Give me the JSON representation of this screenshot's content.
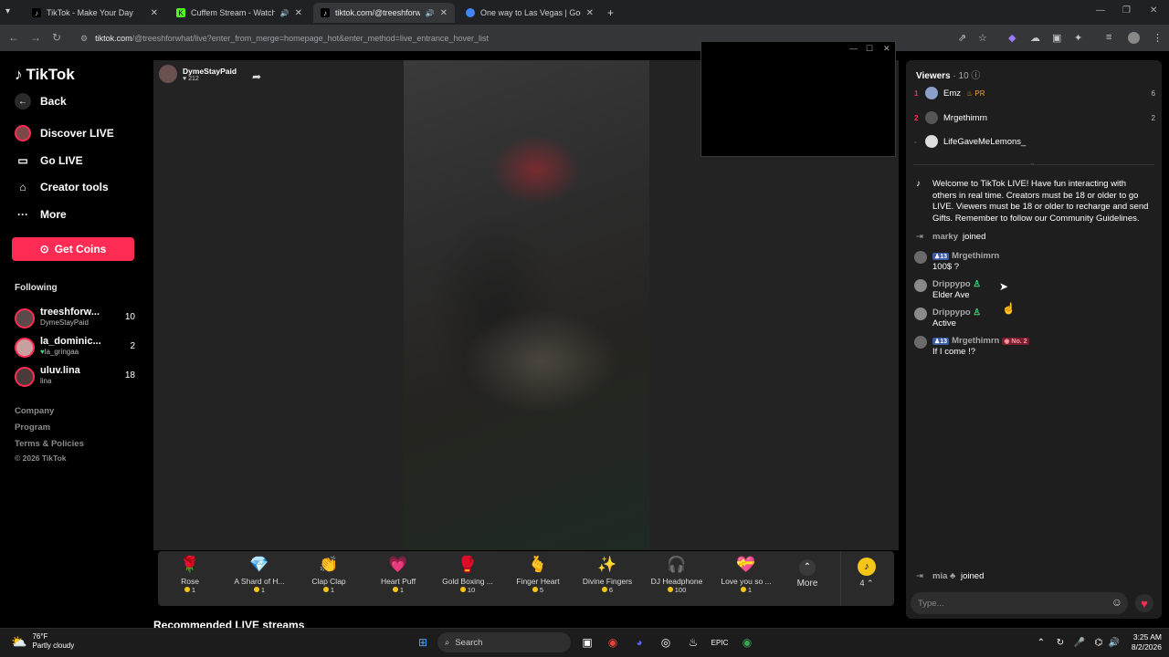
{
  "browser": {
    "tabs": [
      {
        "title": "TikTok - Make Your Day",
        "left": 0
      },
      {
        "title": "Cuffem Stream - Watch Live",
        "left": 0
      },
      {
        "title": "tiktok.com/@treeshforwhat",
        "left": 0
      },
      {
        "title": "One way to Las Vegas | Google",
        "left": 0
      }
    ],
    "url_host": "tiktok.com",
    "url_rest": "/@treeshforwhat/live?enter_from_merge=homepage_hot&enter_method=live_entrance_hover_list"
  },
  "nav": {
    "logo": "TikTok",
    "back": "Back",
    "items": [
      "Discover LIVE",
      "Go LIVE",
      "Creator tools",
      "More"
    ],
    "coins": "Get Coins",
    "following_title": "Following",
    "following": [
      {
        "name": "treeshforw...",
        "sub": "DymeStayPaid",
        "count": "10"
      },
      {
        "name": "la_dominic...",
        "sub": "la_gringaa",
        "count": "2"
      },
      {
        "name": "uluv.lina",
        "sub": "lina",
        "count": "18"
      }
    ],
    "footer": [
      "Company",
      "Program",
      "Terms & Policies",
      "© 2026 TikTok"
    ]
  },
  "stream": {
    "host_name": "DymeStayPaid",
    "host_likes": "212",
    "recommended_title": "Recommended LIVE streams"
  },
  "gifts": [
    {
      "name": "Rose",
      "price": "1",
      "icon": "🌹"
    },
    {
      "name": "A Shard of H...",
      "price": "1",
      "icon": "💎"
    },
    {
      "name": "Clap Clap",
      "price": "1",
      "icon": "👏"
    },
    {
      "name": "Heart Puff",
      "price": "1",
      "icon": "💗"
    },
    {
      "name": "Gold Boxing ...",
      "price": "10",
      "icon": "🥊"
    },
    {
      "name": "Finger Heart",
      "price": "5",
      "icon": "🫰"
    },
    {
      "name": "Divine Fingers",
      "price": "6",
      "icon": "✨"
    },
    {
      "name": "DJ Headphone",
      "price": "100",
      "icon": "🎧"
    },
    {
      "name": "Love you so ...",
      "price": "1",
      "icon": "💝"
    }
  ],
  "gifts_more": "More",
  "coin_balance": "4",
  "viewers": {
    "title": "Viewers",
    "count": "· 10",
    "list": [
      {
        "rank": "1",
        "name": "Emz",
        "score": "6"
      },
      {
        "rank": "2",
        "name": "Mrgethimrn",
        "score": "2"
      },
      {
        "rank": "-",
        "name": "LifeGaveMeLemons_",
        "score": ""
      }
    ]
  },
  "chat": {
    "welcome": "Welcome to TikTok LIVE! Have fun interacting with others in real time. Creators must be 18 or older to go LIVE. Viewers must be 18 or older to recharge and send Gifts. Remember to follow our Community Guidelines.",
    "messages": [
      {
        "user": "marky",
        "text": "joined",
        "kind": "join"
      },
      {
        "user": "Mrgethimrn",
        "level": "13",
        "text": "100$ ?"
      },
      {
        "user": "Drippypo",
        "text": "Elder Ave"
      },
      {
        "user": "Drippypo",
        "text": "Active"
      },
      {
        "user": "Mrgethimrn",
        "level": "13",
        "badge": "No. 2",
        "text": "If I come !?"
      }
    ],
    "join_bottom_user": "mia",
    "join_bottom_text": "joined",
    "placeholder": "Type..."
  },
  "taskbar": {
    "temp": "76°F",
    "weather": "Partly cloudy",
    "search": "Search",
    "time": "3:25 AM",
    "date": "8/2/2026"
  }
}
